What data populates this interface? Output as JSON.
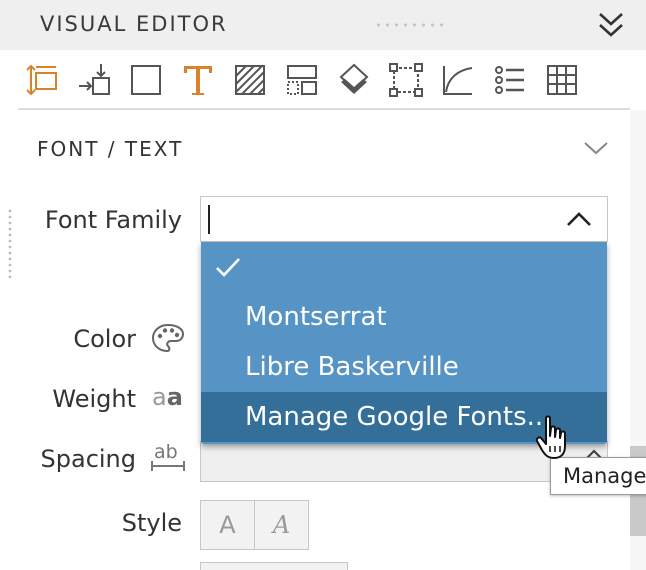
{
  "header": {
    "title": "VISUAL EDITOR"
  },
  "toolbar": {
    "accent_color": "#d9822b",
    "icon_color": "#555555",
    "tools": [
      {
        "icon": "resize-arrows-icon",
        "active": true
      },
      {
        "icon": "align-arrow-icon",
        "active": false
      },
      {
        "icon": "square-icon",
        "active": false
      },
      {
        "icon": "text-t-icon",
        "active": true
      },
      {
        "icon": "hatch-fill-icon",
        "active": false
      },
      {
        "icon": "layout-icon",
        "active": false
      },
      {
        "icon": "diamond-layers-icon",
        "active": false
      },
      {
        "icon": "dotted-box-icon",
        "active": false
      },
      {
        "icon": "curve-icon",
        "active": false
      },
      {
        "icon": "list-icon",
        "active": false
      },
      {
        "icon": "grid-icon",
        "active": false
      }
    ]
  },
  "section": {
    "title": "FONT / TEXT"
  },
  "properties": {
    "font_family_label": "Font Family",
    "font_family_value": "",
    "color_label": "Color",
    "weight_label": "Weight",
    "weight_icon_light": "a",
    "weight_icon_bold": "a",
    "spacing_label": "Spacing",
    "spacing_icon_text": "ab",
    "style_label": "Style",
    "style_normal": "A",
    "style_italic": "A"
  },
  "dropdown": {
    "background": "#5594c5",
    "selected_background": "#336f99",
    "items": [
      {
        "label": "",
        "checked": true
      },
      {
        "label": "Montserrat"
      },
      {
        "label": "Libre Baskerville"
      },
      {
        "label": "Manage Google Fonts...",
        "hovered": true
      }
    ]
  },
  "tooltip": {
    "text": "Manage"
  }
}
